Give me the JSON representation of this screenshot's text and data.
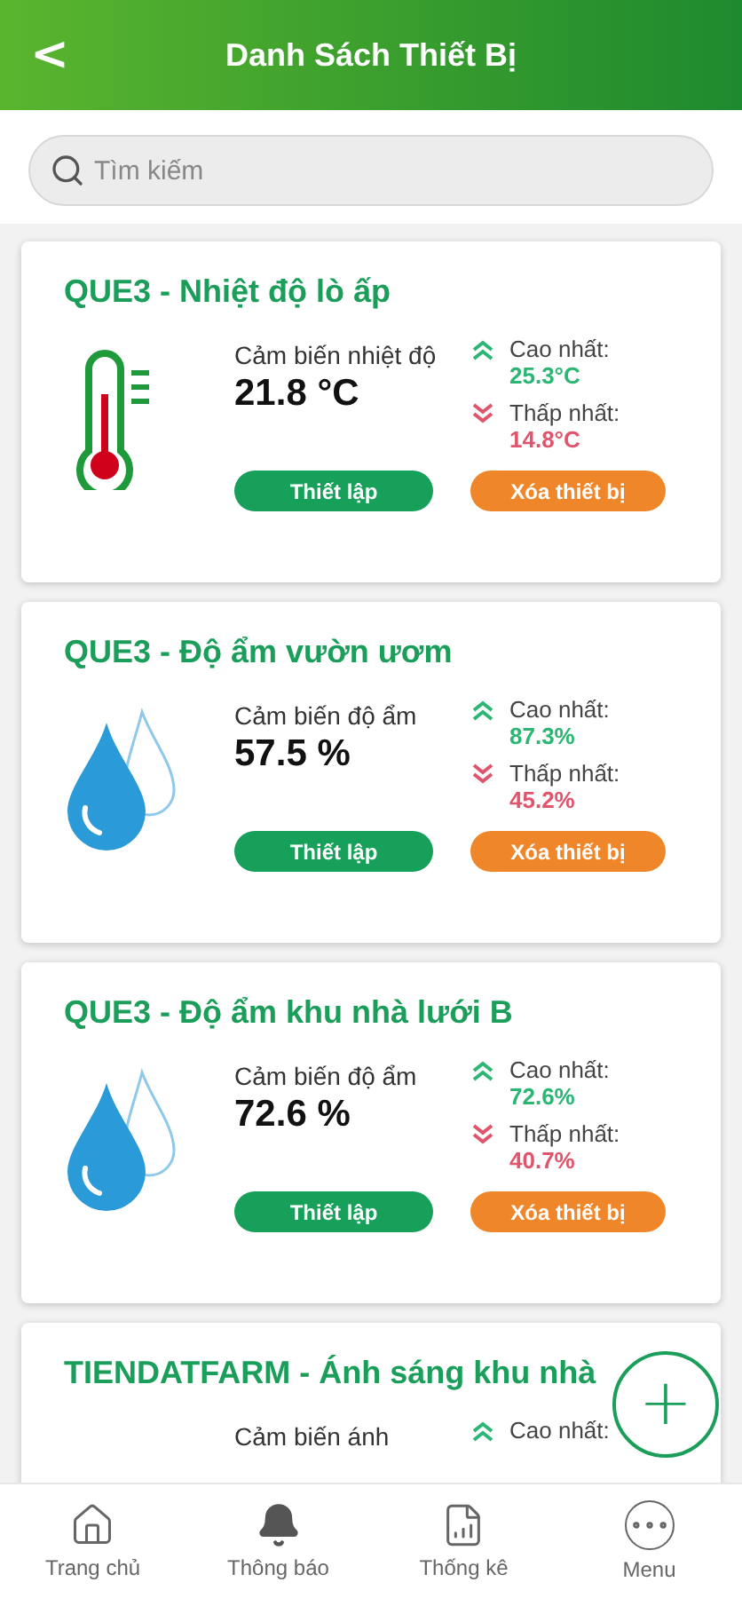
{
  "header": {
    "back": "<",
    "title": "Danh Sách Thiết Bị"
  },
  "search": {
    "placeholder": "Tìm kiếm"
  },
  "devices": [
    {
      "kind": "temperature",
      "title": "QUE3 - Nhiệt độ lò ấp",
      "sensor": "Cảm biến nhiệt độ",
      "value": "21.8 °C",
      "max_label": "Cao nhất:",
      "max": "25.3°C",
      "min_label": "Thấp nhất:",
      "min": "14.8°C",
      "setup": "Thiết lập",
      "delete": "Xóa thiết bị"
    },
    {
      "kind": "humidity",
      "title": "QUE3 - Độ ẩm vườn ươm",
      "sensor": "Cảm biến độ ẩm",
      "value": "57.5 %",
      "max_label": "Cao nhất:",
      "max": "87.3%",
      "min_label": "Thấp nhất:",
      "min": "45.2%",
      "setup": "Thiết lập",
      "delete": "Xóa thiết bị"
    },
    {
      "kind": "humidity",
      "title": "QUE3 - Độ ẩm khu nhà lưới B",
      "sensor": "Cảm biến độ ẩm",
      "value": "72.6 %",
      "max_label": "Cao nhất:",
      "max": "72.6%",
      "min_label": "Thấp nhất:",
      "min": "40.7%",
      "setup": "Thiết lập",
      "delete": "Xóa thiết bị"
    },
    {
      "kind": "light",
      "title": "TIENDATFARM - Ánh sáng khu nhà",
      "sensor": "Cảm biến ánh",
      "max_label": "Cao nhất:"
    }
  ],
  "add_button": {
    "label": "+"
  },
  "nav": [
    {
      "kind": "home",
      "label": "Trang chủ",
      "selected": false
    },
    {
      "kind": "bell",
      "label": "Thông báo",
      "selected": false
    },
    {
      "kind": "report",
      "label": "Thống kê",
      "selected": false
    },
    {
      "kind": "more",
      "label": "Menu",
      "selected": false
    }
  ]
}
